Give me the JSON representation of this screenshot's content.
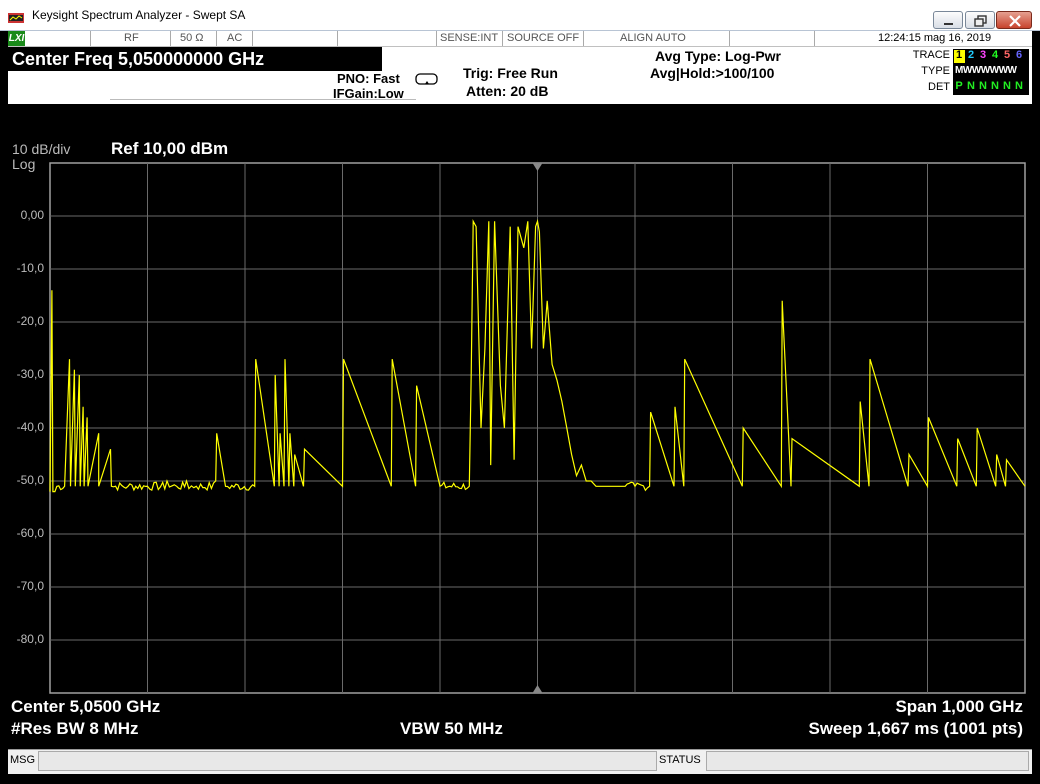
{
  "window": {
    "title": "Keysight Spectrum Analyzer - Swept SA",
    "icon": "spectrum-analyzer-icon"
  },
  "status_strip": {
    "lxi": "LXI",
    "rf": "RF",
    "impedance": "50 Ω",
    "coupling": "AC",
    "sense": "SENSE:INT",
    "source": "SOURCE OFF",
    "align": "ALIGN AUTO",
    "datetime": "12:24:15 mag 16, 2019"
  },
  "header": {
    "center_freq": "Center Freq 5,050000000 GHz",
    "pno": "PNO: Fast",
    "ifgain": "IFGain:Low",
    "trig": "Trig: Free Run",
    "atten": "Atten: 20 dB",
    "avg_type": "Avg Type: Log-Pwr",
    "avg_hold": "Avg|Hold:>100/100",
    "trace_label": "TRACE",
    "type_label": "TYPE",
    "det_label": "DET",
    "trace_numbers": [
      "1",
      "2",
      "3",
      "4",
      "5",
      "6"
    ],
    "trace_colors": [
      "#ffff00",
      "#22ccff",
      "#ff44ff",
      "#22ff22",
      "#ff6666",
      "#6666ff"
    ],
    "type_row": "MWWWWWW",
    "det_row": [
      "P",
      "N",
      "N",
      "N",
      "N",
      "N"
    ]
  },
  "display": {
    "scale": "10 dB/div",
    "log": "Log",
    "ref": "Ref 10,00 dBm",
    "yticks": [
      "0,00",
      "-10,0",
      "-20,0",
      "-30,0",
      "-40,0",
      "-50,0",
      "-60,0",
      "-70,0",
      "-80,0"
    ],
    "center_label": "Center 5,0500 GHz",
    "span_label": "Span 1,000 GHz",
    "res_bw": "#Res BW 8 MHz",
    "vbw": "VBW 50 MHz",
    "sweep": "Sweep  1,667 ms (1001 pts)",
    "trace_color": "#ffff00",
    "grid_color": "#6a6a6a"
  },
  "chart_data": {
    "type": "line",
    "xlim": [
      4.55,
      5.55
    ],
    "ylim": [
      -90,
      10
    ],
    "x_unit": "GHz",
    "y_unit": "dBm",
    "noise_floor": -51,
    "series": [
      {
        "x": [
          4.55,
          4.552,
          4.553,
          4.555,
          4.565,
          4.57,
          4.571,
          4.575,
          4.576,
          4.58,
          4.581,
          4.584,
          4.585,
          4.588,
          4.589,
          4.6,
          4.6,
          4.612,
          4.613,
          4.63,
          4.65,
          4.67,
          4.68,
          4.69,
          4.7,
          4.72,
          4.721,
          4.73,
          4.76,
          4.761,
          4.78,
          4.781,
          4.785,
          4.786,
          4.79,
          4.791,
          4.795,
          4.796,
          4.8,
          4.801,
          4.81,
          4.811,
          4.85,
          4.851,
          4.9,
          4.901,
          4.925,
          4.926,
          4.95,
          4.98,
          4.982,
          4.984,
          4.987,
          4.992,
          4.996,
          5.0,
          5.002,
          5.006,
          5.012,
          5.016,
          5.022,
          5.026,
          5.03,
          5.036,
          5.04,
          5.044,
          5.048,
          5.05,
          5.052,
          5.056,
          5.06,
          5.065,
          5.07,
          5.075,
          5.08,
          5.085,
          5.09,
          5.095,
          5.1,
          5.105,
          5.11,
          5.115,
          5.12,
          5.125,
          5.13,
          5.135,
          5.14,
          5.15,
          5.165,
          5.166,
          5.19,
          5.191,
          5.2,
          5.201,
          5.26,
          5.261,
          5.3,
          5.301,
          5.31,
          5.311,
          5.38,
          5.381,
          5.39,
          5.391,
          5.43,
          5.431,
          5.45,
          5.451,
          5.48,
          5.481,
          5.5,
          5.501,
          5.52,
          5.521,
          5.53,
          5.531,
          5.55
        ],
        "y": [
          -52,
          -14,
          -52,
          -52,
          -51,
          -27,
          -51,
          -29,
          -51,
          -30,
          -51,
          -36,
          -51,
          -38,
          -51,
          -41,
          -51,
          -44,
          -51,
          -51,
          -51,
          -50,
          -51,
          -50,
          -51,
          -50,
          -41,
          -51,
          -51,
          -27,
          -51,
          -30,
          -51,
          -41,
          -51,
          -27,
          -51,
          -41,
          -51,
          -45,
          -51,
          -44,
          -51,
          -27,
          -51,
          -27,
          -51,
          -32,
          -51,
          -51,
          -30,
          -1,
          -2,
          -40,
          -25,
          -1,
          -47,
          -1,
          -32,
          -40,
          -2,
          -46,
          -2,
          -6,
          -1,
          -25,
          -2,
          -1,
          -3,
          -25,
          -16,
          -28,
          -31,
          -35,
          -40,
          -45,
          -49,
          -47,
          -50,
          -50,
          -51,
          -51,
          -51,
          -51,
          -51,
          -51,
          -51,
          -51,
          -51,
          -37,
          -51,
          -36,
          -51,
          -27,
          -51,
          -40,
          -51,
          -16,
          -51,
          -42,
          -51,
          -35,
          -51,
          -27,
          -51,
          -45,
          -51,
          -38,
          -51,
          -42,
          -51,
          -40,
          -51,
          -45,
          -51,
          -46,
          -51
        ]
      }
    ]
  }
}
